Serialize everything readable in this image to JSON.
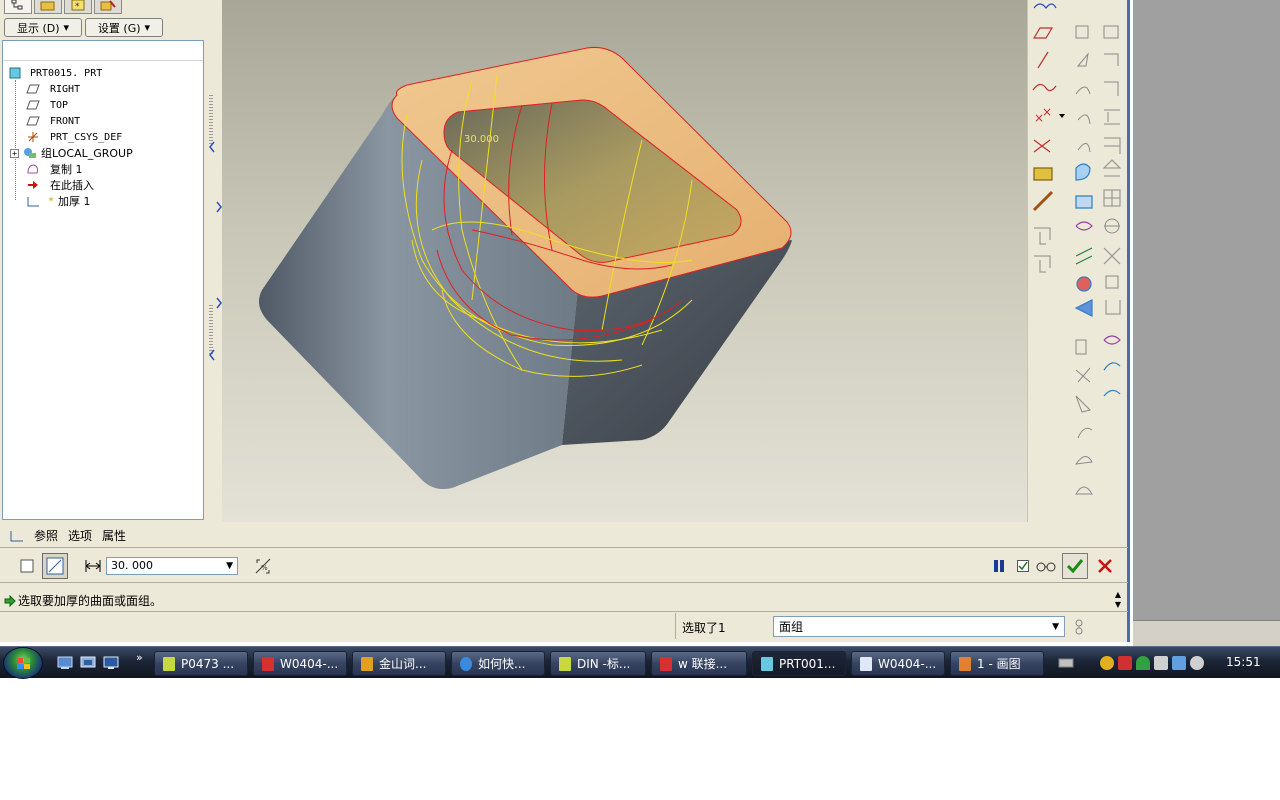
{
  "left_panel": {
    "display_menu": "显示 (D)",
    "settings_menu": "设置 (G)",
    "tree": [
      {
        "label": "PRT0015. PRT",
        "icon": "part-icon"
      },
      {
        "label": "RIGHT",
        "icon": "datum-plane-icon"
      },
      {
        "label": "TOP",
        "icon": "datum-plane-icon"
      },
      {
        "label": "FRONT",
        "icon": "datum-plane-icon"
      },
      {
        "label": "PRT_CSYS_DEF",
        "icon": "csys-icon"
      },
      {
        "label": "组LOCAL_GROUP",
        "icon": "group-icon"
      },
      {
        "label": "复制 1",
        "icon": "copy-icon"
      },
      {
        "label": "在此插入",
        "icon": "insert-here-arrow-icon"
      },
      {
        "label": "加厚 1",
        "icon": "thicken-icon"
      }
    ]
  },
  "viewport": {
    "dimension_label": "30.000"
  },
  "dashboard": {
    "tabs": [
      "参照",
      "选项",
      "属性"
    ],
    "thickness_value": "30. 000",
    "pause_icon": "pause-icon",
    "preview_icon": "glasses-preview-icon",
    "ok_icon": "checkmark-icon",
    "cancel_icon": "x-cancel-icon",
    "colors": {
      "ok": "#1a8a1a",
      "cancel": "#cc1111"
    }
  },
  "message": {
    "text": "选取要加厚的曲面或面组。"
  },
  "status": {
    "selected": "选取了1",
    "filter": "面组"
  },
  "taskbar": {
    "buttons": [
      {
        "label": "P0473 ...",
        "active": false
      },
      {
        "label": "W0404-...",
        "active": false
      },
      {
        "label": "金山词...",
        "active": false
      },
      {
        "label": "如何快...",
        "active": false
      },
      {
        "label": "DIN -标...",
        "active": false
      },
      {
        "label": "w  联接...",
        "active": false
      },
      {
        "label": "PRT001...",
        "active": true
      },
      {
        "label": "W0404-...",
        "active": false
      },
      {
        "label": "1 - 画图",
        "active": false
      }
    ],
    "clock": "15:51"
  }
}
